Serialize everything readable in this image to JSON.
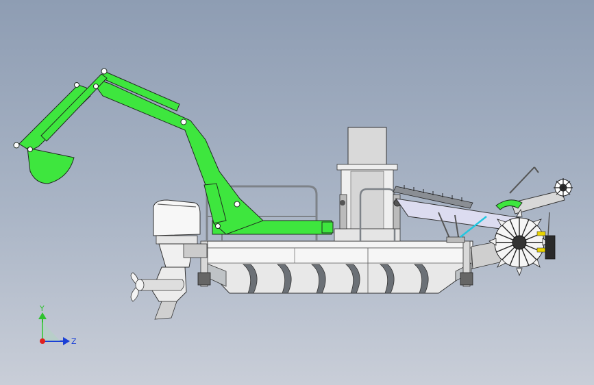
{
  "viewport": {
    "background_top": "#8e9db3",
    "background_bottom": "#c9ced8"
  },
  "colors": {
    "excavator_green": "#3ee63e",
    "outline": "#1f2a1f",
    "hull_light": "#e6e6e6",
    "hull_shadow": "#9aa0a6",
    "motor_white": "#f2f2f2",
    "frame": "#cfd3d6",
    "hydraulic_cyan": "#22c7e0",
    "accent_yellow": "#e9d400",
    "dark": "#222222"
  },
  "triad": {
    "y_label": "Y",
    "z_label": "Z",
    "y_color": "#2ec22e",
    "z_color": "#1a3fd6",
    "origin_color": "#e0201f"
  },
  "icons": [
    "coordinate-triad-icon"
  ]
}
